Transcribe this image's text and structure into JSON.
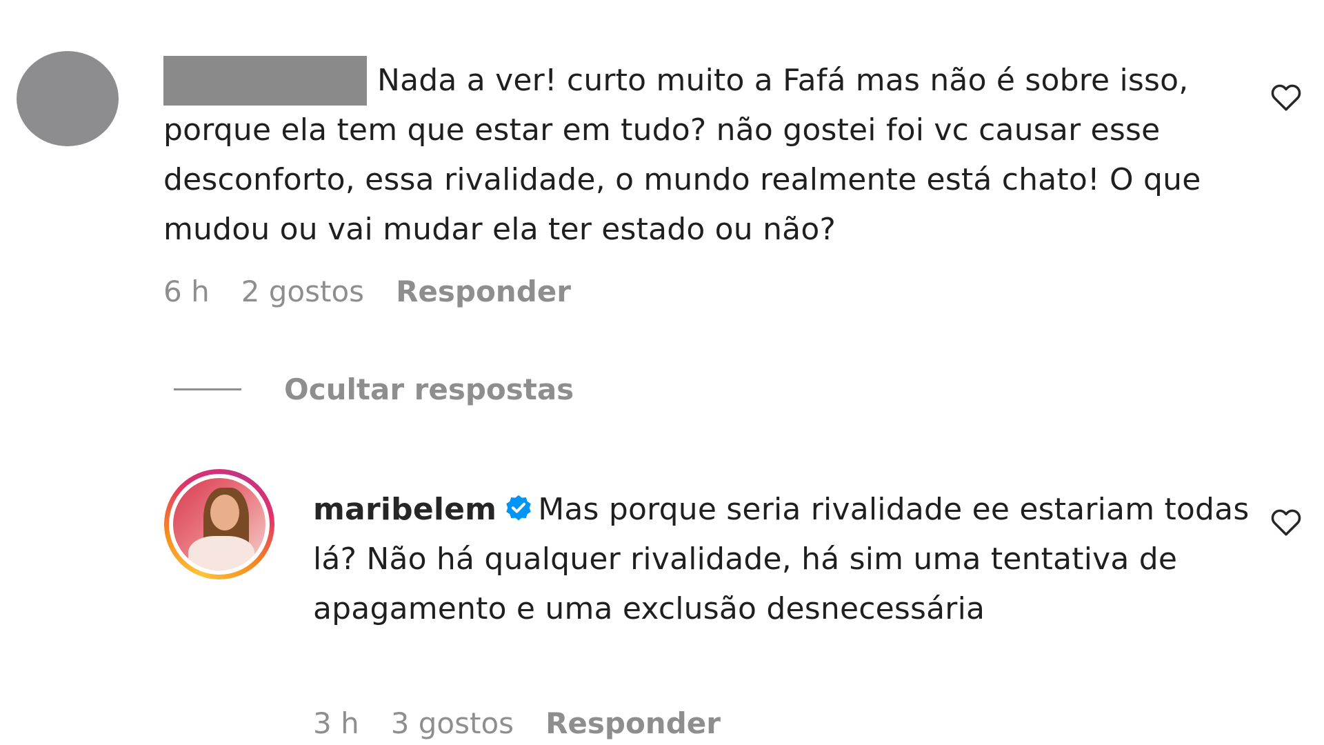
{
  "comments": [
    {
      "text": "Nada a ver! curto muito a Fafá mas não é sobre isso, porque ela tem que estar em tudo? não gostei foi vc causar esse desconforto, essa rivalidade, o mundo realmente está chato! O que mudou ou vai mudar ela ter estado ou não?",
      "time": "6 h",
      "likes": "2 gostos",
      "reply_label": "Responder",
      "icon": "heart-outline-icon"
    }
  ],
  "thread": {
    "toggle_label": "Ocultar respostas"
  },
  "replies": [
    {
      "username": "maribelem",
      "verified": true,
      "text": "Mas porque seria rivalidade ee estariam todas lá? Não há qualquer rivalidade, há sim uma tentativa de apagamento e uma exclusão desnecessária",
      "time": "3 h",
      "likes": "3 gostos",
      "reply_label": "Responder",
      "icon": "heart-outline-icon"
    }
  ],
  "colors": {
    "verified": "#0095f6",
    "meta_text": "#8e8e8e",
    "redaction": "#8a8a8a",
    "avatar_placeholder": "#8d8d8f"
  }
}
